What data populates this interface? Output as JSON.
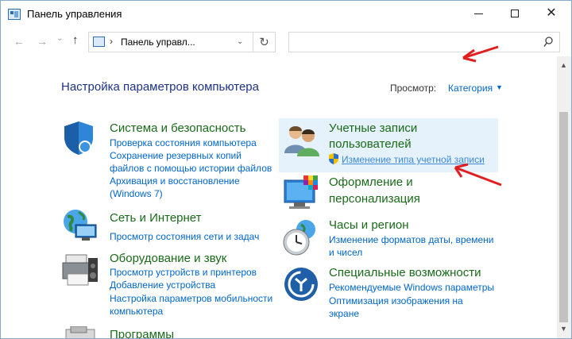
{
  "window": {
    "title": "Панель управления",
    "icon": "control-panel-icon"
  },
  "nav": {
    "address": "Панель управл...",
    "search_placeholder": ""
  },
  "header": {
    "heading": "Настройка параметров компьютера",
    "viewby_label": "Просмотр:",
    "viewby_value": "Категория"
  },
  "categories": {
    "system": {
      "title": "Система и безопасность",
      "links": [
        "Проверка состояния компьютера",
        "Сохранение резервных копий",
        "файлов с помощью истории файлов",
        "Архивация и восстановление",
        "(Windows 7)"
      ]
    },
    "network": {
      "title": "Сеть и Интернет",
      "links": [
        "Просмотр состояния сети и задач"
      ]
    },
    "hardware": {
      "title": "Оборудование и звук",
      "links": [
        "Просмотр устройств и принтеров",
        "Добавление устройства",
        "Настройка параметров мобильности",
        "компьютера"
      ]
    },
    "programs": {
      "title": "Программы"
    },
    "accounts": {
      "title_line1": "Учетные записи",
      "title_line2": "пользователей",
      "links": [
        "Изменение типа учетной записи"
      ]
    },
    "appearance": {
      "title_line1": "Оформление и",
      "title_line2": "персонализация"
    },
    "clock": {
      "title": "Часы и регион",
      "links": [
        "Изменение форматов даты, времени",
        "и чисел"
      ]
    },
    "ease": {
      "title": "Специальные возможности",
      "links": [
        "Рекомендуемые Windows параметры",
        "Оптимизация изображения на",
        "экране"
      ]
    }
  },
  "colors": {
    "category_title": "#1a6a1a",
    "link": "#0066cc",
    "heading": "#1e3287",
    "annotation_arrow": "#e02020"
  }
}
